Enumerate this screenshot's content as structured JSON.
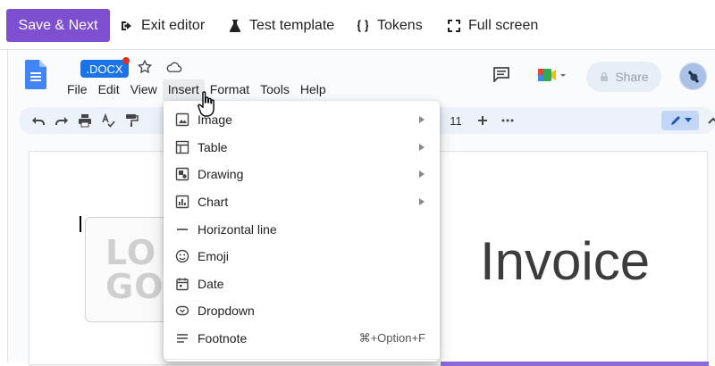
{
  "editor_toolbar": {
    "save_next": "Save & Next",
    "exit_editor": "Exit editor",
    "test_template": "Test template",
    "tokens": "Tokens",
    "full_screen": "Full screen"
  },
  "docs": {
    "file_badge": ".DOCX",
    "menu": [
      "File",
      "Edit",
      "View",
      "Insert",
      "Format",
      "Tools",
      "Help"
    ],
    "active_menu": "Insert",
    "share_label": "Share",
    "font_size": "11"
  },
  "insert_menu": {
    "items": [
      {
        "label": "Image",
        "icon": "image-icon",
        "submenu": true
      },
      {
        "label": "Table",
        "icon": "table-icon",
        "submenu": true
      },
      {
        "label": "Drawing",
        "icon": "drawing-icon",
        "submenu": true
      },
      {
        "label": "Chart",
        "icon": "chart-icon",
        "submenu": true
      },
      {
        "label": "Horizontal line",
        "icon": "horizontal-line-icon",
        "submenu": false
      },
      {
        "label": "Emoji",
        "icon": "emoji-icon",
        "submenu": false
      },
      {
        "label": "Date",
        "icon": "calendar-icon",
        "submenu": false
      },
      {
        "label": "Dropdown",
        "icon": "dropdown-chip-icon",
        "submenu": false
      },
      {
        "label": "Footnote",
        "icon": "footnote-icon",
        "submenu": false,
        "shortcut": "⌘+Option+F"
      }
    ]
  },
  "document": {
    "logo_placeholder": "LO GO",
    "title": "Invoice"
  },
  "colors": {
    "primary": "#7e4fd0",
    "docx_badge": "#1a73e8",
    "accent_line": "#8a6ad8"
  }
}
